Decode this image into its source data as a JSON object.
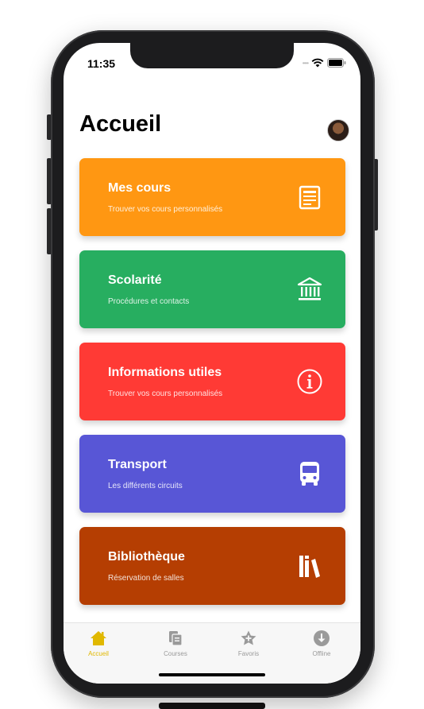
{
  "status_bar": {
    "time": "11:35",
    "wifi_icon": "wifi-icon",
    "battery_icon": "battery-icon"
  },
  "header": {
    "title": "Accueil",
    "avatar_icon": "avatar"
  },
  "cards": [
    {
      "title": "Mes cours",
      "subtitle": "Trouver vos cours personnalisés",
      "icon": "book-icon",
      "color": "#ff9712"
    },
    {
      "title": "Scolarité",
      "subtitle": "Procédures et contacts",
      "icon": "bank-icon",
      "color": "#27ae60"
    },
    {
      "title": "Informations utiles",
      "subtitle": "Trouver vos cours personnalisés",
      "icon": "info-icon",
      "color": "#ff3a35"
    },
    {
      "title": "Transport",
      "subtitle": "Les différents circuits",
      "icon": "bus-icon",
      "color": "#5856d6"
    },
    {
      "title": "Bibliothèque",
      "subtitle": "Réservation de salles",
      "icon": "library-icon",
      "color": "#b53e02"
    }
  ],
  "tabbar": {
    "active_color": "#e0b800",
    "inactive_color": "#9a9a9a",
    "items": [
      {
        "label": "Accueil",
        "icon": "home-icon",
        "active": true
      },
      {
        "label": "Courses",
        "icon": "courses-icon",
        "active": false
      },
      {
        "label": "Favoris",
        "icon": "star-icon",
        "active": false
      },
      {
        "label": "Offline",
        "icon": "download-icon",
        "active": false
      }
    ]
  }
}
